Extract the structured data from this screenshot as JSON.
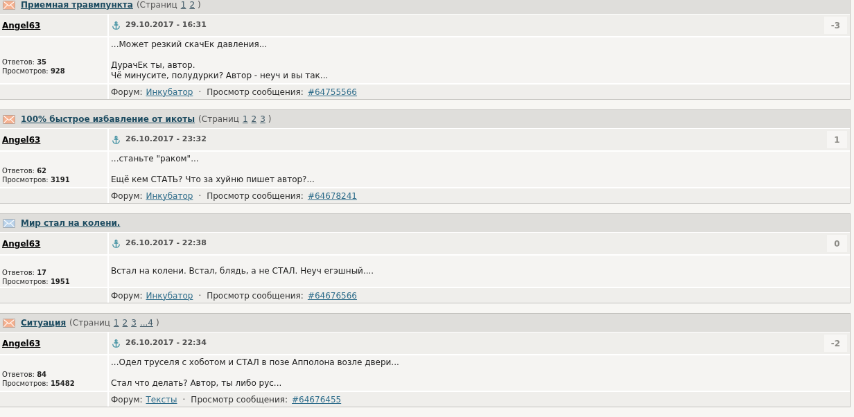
{
  "posts": [
    {
      "topic": {
        "title": "Приемная травмпункта",
        "color": "#f5b08f",
        "pages_label": "(Страниц",
        "pages": [
          "1",
          "2"
        ],
        "pages_close": ")"
      },
      "author": "Angel63",
      "date": "29.10.2017 - 16:31",
      "rating": "-3",
      "stats": [
        {
          "label": "Ответов:",
          "value": "35"
        },
        {
          "label": "Просмотров:",
          "value": "928"
        }
      ],
      "quote": "...Может резкий скачЕк давления...",
      "text": [
        "ДурачЕк ты, автор.",
        "Чё минусите, полудурки? Автор - неуч и вы так..."
      ],
      "footer": {
        "forum_label": "Форум:",
        "forum": "Инкубатор",
        "separator": "·",
        "view_label": "Просмотр сообщения:",
        "message_id": "#64755566"
      }
    },
    {
      "topic": {
        "title": "100% быстрое избавление от икоты",
        "color": "#f5b08f",
        "pages_label": "(Страниц",
        "pages": [
          "1",
          "2",
          "3"
        ],
        "pages_close": ")"
      },
      "author": "Angel63",
      "date": "26.10.2017 - 23:32",
      "rating": "1",
      "stats": [
        {
          "label": "Ответов:",
          "value": "62"
        },
        {
          "label": "Просмотров:",
          "value": "3191"
        }
      ],
      "quote": "...станьте \"раком\"...",
      "text": [
        "Ещё кем СТАТЬ? Что за хуйню пишет автор?..."
      ],
      "footer": {
        "forum_label": "Форум:",
        "forum": "Инкубатор",
        "separator": "·",
        "view_label": "Просмотр сообщения:",
        "message_id": "#64678241"
      }
    },
    {
      "topic": {
        "title": "Мир стал на колени.",
        "color": "#b9d2ea"
      },
      "author": "Angel63",
      "date": "26.10.2017 - 22:38",
      "rating": "0",
      "stats": [
        {
          "label": "Ответов:",
          "value": "17"
        },
        {
          "label": "Просмотров:",
          "value": "1951"
        }
      ],
      "text": [
        "Встал на колени. Встал, блядь, а не СТАЛ. Неуч егэшный...."
      ],
      "footer": {
        "forum_label": "Форум:",
        "forum": "Инкубатор",
        "separator": "·",
        "view_label": "Просмотр сообщения:",
        "message_id": "#64676566"
      }
    },
    {
      "topic": {
        "title": "Ситуация",
        "color": "#f5b08f",
        "pages_label": "(Страниц",
        "pages": [
          "1",
          "2",
          "3",
          "...4"
        ],
        "pages_close": ")"
      },
      "author": "Angel63",
      "date": "26.10.2017 - 22:34",
      "rating": "-2",
      "stats": [
        {
          "label": "Ответов:",
          "value": "84"
        },
        {
          "label": "Просмотров:",
          "value": "15482"
        }
      ],
      "quote": "...Одел труселя с хоботом и СТАЛ в позе Апполона возле двери...",
      "text": [
        "Стал что делать? Автор, ты либо рус..."
      ],
      "footer": {
        "forum_label": "Форум:",
        "forum": "Тексты",
        "separator": "·",
        "view_label": "Просмотр сообщения:",
        "message_id": "#64676455"
      }
    }
  ]
}
